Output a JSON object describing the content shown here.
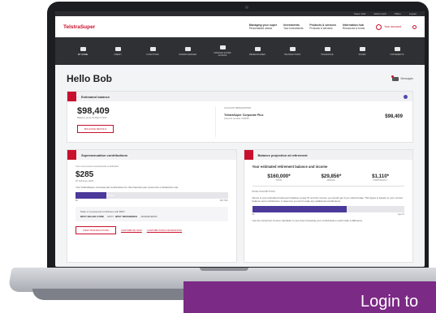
{
  "topbar": [
    "Super Hub",
    "Advice Hub",
    "Offers",
    "Logout"
  ],
  "brand": {
    "name": "TelstraSuper",
    "color": "#c8102e"
  },
  "header_nav": [
    {
      "title": "Managing your super",
      "sub": "Personalised advice"
    },
    {
      "title": "Investments",
      "sub": "Your investments"
    },
    {
      "title": "Products & services",
      "sub": "Products & services"
    },
    {
      "title": "Information hub",
      "sub": "Resources & forms"
    }
  ],
  "account_label": "Your account",
  "nav": [
    {
      "label": "MY HOME",
      "icon": "home-icon"
    },
    {
      "label": "CREDIT",
      "icon": "coins-icon"
    },
    {
      "label": "FUNCTIONS",
      "icon": "functions-icon"
    },
    {
      "label": "SUPERCHARGER",
      "icon": "chart-icon"
    },
    {
      "label": "MANAGE SUPER ACCESS",
      "icon": "graph-icon"
    },
    {
      "label": "BENEFICIARIES",
      "icon": "umbrella-icon"
    },
    {
      "label": "TRANSACTIONS",
      "icon": "transactions-icon"
    },
    {
      "label": "INSURANCE",
      "icon": "insurance-icon"
    },
    {
      "label": "SUPER",
      "icon": "folder-icon"
    },
    {
      "label": "STATEMENTS",
      "icon": "statements-icon"
    }
  ],
  "greeting": "Hello Bob",
  "messages_label": "Messages",
  "estimated_balance": {
    "title": "Estimated balance",
    "amount": "$98,409",
    "as_at": "Balance as at 23 March 2023",
    "button": "BALANCE DETAILS",
    "account_label": "ACCOUNT BREAKDOWN",
    "account_name": "TelstraSuper Corporate Plus",
    "account_number": "Account number 123456",
    "account_amount": "$98,409"
  },
  "contributions": {
    "title": "Superannuation contributions",
    "intro": "Your most recent concessional contribution",
    "amount": "$285",
    "date": "20 February 2023",
    "text": "Your TelstraSuper concessional contributions for this financial year versus the contributions cap",
    "bar_label": "$5,659",
    "bar_fraction": 0.2,
    "axis_min": "$0",
    "axis_max": "$27,500",
    "info_text": "Make a concessional contribution with BPAY",
    "biller_code_label": "BPAY BILLER CODE",
    "biller_code": "54973",
    "reference_label": "BPAY REFERENCE",
    "reference": "2600000198026",
    "button": "VIEW TRANSACTIONS",
    "link1": "CONTRIBUTE NOW",
    "link2": "CONTRIBUTIONS INFORMATION"
  },
  "projection": {
    "title": "Balance projection at retirement",
    "subtitle": "Your estimated retirement balance and income",
    "stats": [
      {
        "value": "$160,000*",
        "label": "TOTAL"
      },
      {
        "value": "$29,856*",
        "label": "ANNUAL"
      },
      {
        "value": "$1,110*",
        "label": "FORTNIGHTLY"
      }
    ],
    "assumptions": "BASE ASSUMPTIONS",
    "text": "Above is your estimated retirement balance at age 67 and the income you would get if you retired today. This figure is based on your current balance and contributions. It assumes you don't make any additional contributions.",
    "bar_fraction": 0.62,
    "axis_min": "$0",
    "axis_max": "Age 67",
    "footer": "Use the retirement income calculator to see how increasing your contributions could make a difference"
  },
  "banner_text": "Login to",
  "banner_color": "#7b2a85"
}
